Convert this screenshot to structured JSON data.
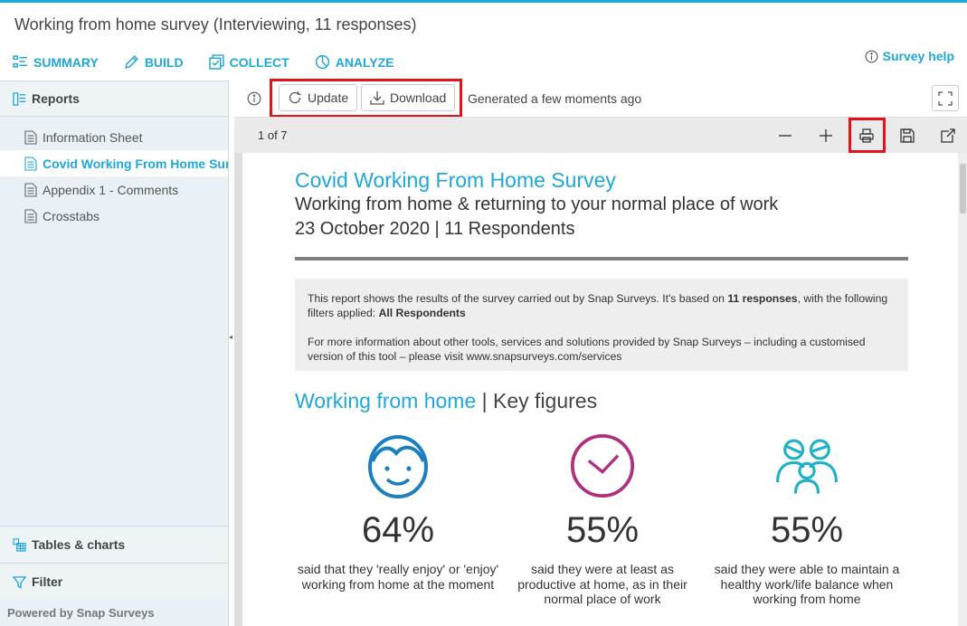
{
  "window": {
    "title": "Working from home survey (Interviewing, 11 responses)"
  },
  "nav": {
    "items": [
      {
        "label": "SUMMARY",
        "icon": "summary-icon"
      },
      {
        "label": "BUILD",
        "icon": "pencil-icon"
      },
      {
        "label": "COLLECT",
        "icon": "collect-icon"
      },
      {
        "label": "ANALYZE",
        "icon": "analyze-icon"
      }
    ],
    "help_label": "Survey help"
  },
  "sidebar": {
    "header": "Reports",
    "reports": [
      {
        "label": "Information Sheet",
        "active": false
      },
      {
        "label": "Covid Working From Home Survey",
        "active": true
      },
      {
        "label": "Appendix 1 - Comments",
        "active": false
      },
      {
        "label": "Crosstabs",
        "active": false
      }
    ],
    "tables_label": "Tables & charts",
    "filter_label": "Filter",
    "powered_by": "Powered by Snap Surveys"
  },
  "toolbar": {
    "update_label": "Update",
    "download_label": "Download",
    "generated_text": "Generated a few moments ago"
  },
  "viewer": {
    "page_indicator": "1 of 7"
  },
  "document": {
    "title": "Covid Working From Home Survey",
    "subtitle": "Working from home & returning to your normal place of work",
    "date_line": "23 October 2020 | 11 Respondents",
    "info_p1_a": "This report shows the results of the survey carried out by Snap Surveys. It's based on ",
    "info_p1_b": "11 responses",
    "info_p1_c": ", with the following filters applied: ",
    "info_p1_d": "All Respondents",
    "info_p2": "For more information about other tools, services and solutions provided by Snap Surveys – including a customised version of this tool – please visit www.snapsurveys.com/services",
    "section_blue": "Working from home",
    "section_sep": " | ",
    "section_dark": "Key figures",
    "figures": [
      {
        "icon": "smiley-face-icon",
        "percent": "64%",
        "text": "said that they 'really enjoy' or 'enjoy' working from home at the moment",
        "color": "#1a7fc1"
      },
      {
        "icon": "clock-icon",
        "percent": "55%",
        "text": "said they were at least as productive at home, as in their normal place of work",
        "color": "#b0307f"
      },
      {
        "icon": "family-icon",
        "percent": "55%",
        "text": "said they were able to maintain a healthy work/life balance when working from home",
        "color": "#20b1c8"
      }
    ]
  },
  "colors": {
    "accent": "#1ea7d8",
    "highlight": "#e1141c"
  }
}
